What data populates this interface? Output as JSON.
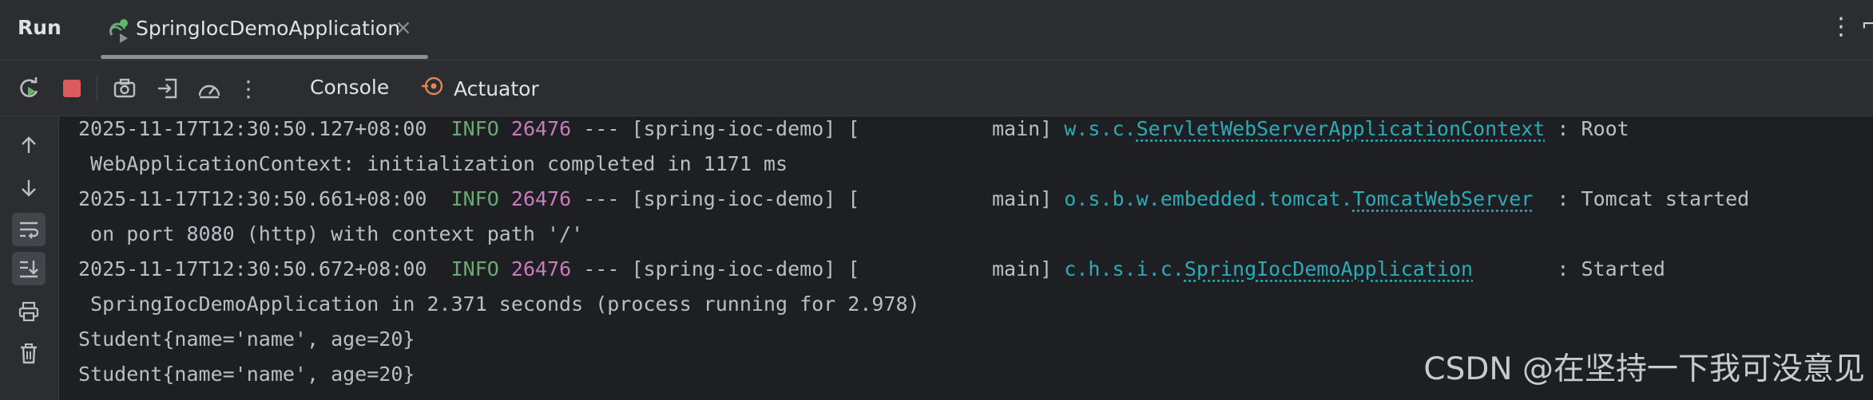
{
  "window": {
    "title": "Run"
  },
  "tabs": [
    {
      "label": "SpringIocDemoApplication",
      "close": "×"
    }
  ],
  "toolbar": {
    "console_label": "Console",
    "actuator_label": "Actuator",
    "more": "⋮"
  },
  "header": {
    "more": "⋮",
    "edge": "⌐"
  },
  "console": {
    "lines": [
      {
        "timestamp": "2025-11-17T12:30:50.127+08:00",
        "level": "INFO",
        "pid": "26476",
        "sep": "---",
        "app": "[spring-ioc-demo] [           main]",
        "logger_prefix": "w.s.c.",
        "logger_class": "ServletWebServerApplicationContext",
        "message": " : Root",
        "continuation": " WebApplicationContext: initialization completed in 1171 ms"
      },
      {
        "timestamp": "2025-11-17T12:30:50.661+08:00",
        "level": "INFO",
        "pid": "26476",
        "sep": "---",
        "app": "[spring-ioc-demo] [           main]",
        "logger_prefix": "o.s.b.w.embedded.tomcat.",
        "logger_class": "TomcatWebServer",
        "message": "  : Tomcat started",
        "continuation": " on port 8080 (http) with context path '/'"
      },
      {
        "timestamp": "2025-11-17T12:30:50.672+08:00",
        "level": "INFO",
        "pid": "26476",
        "sep": "---",
        "app": "[spring-ioc-demo] [           main]",
        "logger_prefix": "c.h.s.i.c.",
        "logger_class": "SpringIocDemoApplication",
        "message": "       : Started",
        "continuation": " SpringIocDemoApplication in 2.371 seconds (process running for 2.978)"
      }
    ],
    "output": [
      "Student{name='name', age=20}",
      "Student{name='name', age=20}"
    ]
  },
  "watermark": "CSDN @在坚持一下我可没意见",
  "colors": {
    "info": "#6aab73",
    "pid": "#c77dbb",
    "logger": "#2aacb8",
    "stop": "#db5c5c",
    "run": "#5fb865"
  },
  "icons": [
    "rerun-icon",
    "stop-icon",
    "screenshot-icon",
    "exit-icon",
    "profiler-icon",
    "more-icon",
    "actuator-icon",
    "scroll-up-icon",
    "scroll-down-icon",
    "soft-wrap-icon",
    "scroll-to-end-icon",
    "print-icon",
    "clear-icon",
    "close-icon"
  ]
}
